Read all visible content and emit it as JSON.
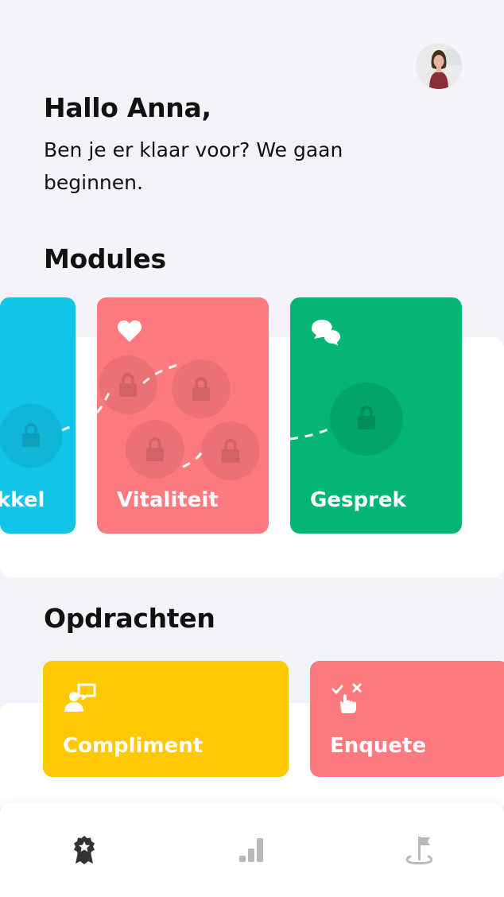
{
  "user": {
    "greeting": "Hallo Anna,",
    "subtitle": "Ben je er klaar voor? We gaan beginnen."
  },
  "modules": {
    "title": "Modules",
    "cards": [
      {
        "label": "kkel",
        "color": "#12c4e8",
        "locked": true
      },
      {
        "label": "Vitaliteit",
        "color": "#fe7a7f",
        "icon": "heart-icon",
        "locked": true
      },
      {
        "label": "Gesprek",
        "color": "#03b575",
        "icon": "chat-bubbles-icon",
        "locked": true
      }
    ]
  },
  "tasks": {
    "title": "Opdrachten",
    "cards": [
      {
        "label": "Compliment",
        "color": "#fec803",
        "icon": "compliment-icon"
      },
      {
        "label": "Enquete",
        "color": "#fe7a7f",
        "icon": "survey-icon"
      }
    ]
  },
  "nav": {
    "items": [
      "badge-icon",
      "stats-icon",
      "golf-flag-icon"
    ],
    "active": 0
  }
}
